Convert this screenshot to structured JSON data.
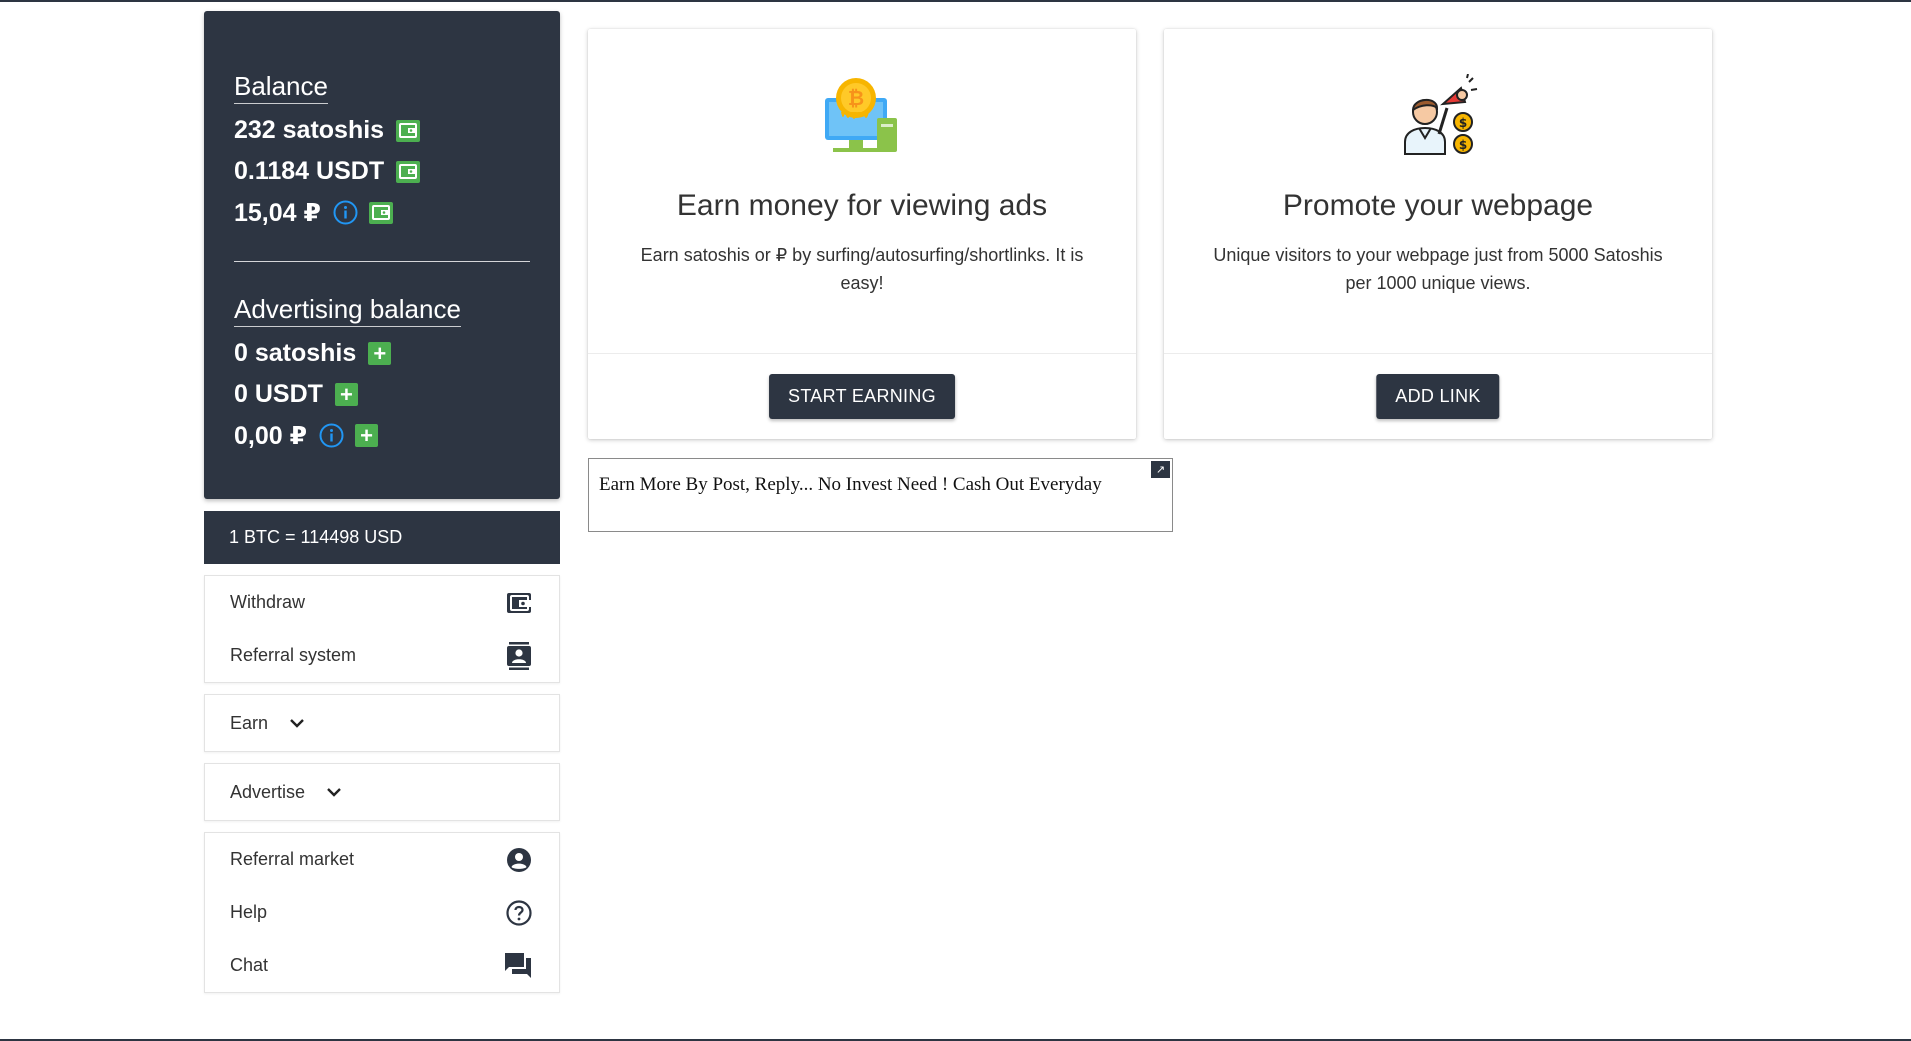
{
  "balance": {
    "heading": "Balance",
    "lines": [
      "232 satoshis",
      "0.1184 USDT",
      "15,04 ₽"
    ]
  },
  "advertising": {
    "heading": "Advertising balance",
    "lines": [
      "0 satoshis",
      "0 USDT",
      "0,00 ₽"
    ]
  },
  "rate": "1 BTC = 114498 USD",
  "menu": {
    "withdraw": "Withdraw",
    "referral_system": "Referral system",
    "earn": "Earn",
    "advertise": "Advertise",
    "referral_market": "Referral market",
    "help": "Help",
    "chat": "Chat"
  },
  "cards": [
    {
      "title": "Earn money for viewing ads",
      "desc": "Earn satoshis or ₽ by surfing/autosurfing/shortlinks. It is easy!",
      "button": "START EARNING"
    },
    {
      "title": "Promote your webpage",
      "desc": "Unique visitors to your webpage just from 5000 Satoshis per 1000 unique views.",
      "button": "ADD LINK"
    }
  ],
  "ad": {
    "text": "Earn More By Post, Reply... No Invest Need ! Cash Out Everyday",
    "corner": "↗"
  },
  "colors": {
    "dark": "#2d3542",
    "green": "#4caf50",
    "info_blue": "#2196f3"
  }
}
